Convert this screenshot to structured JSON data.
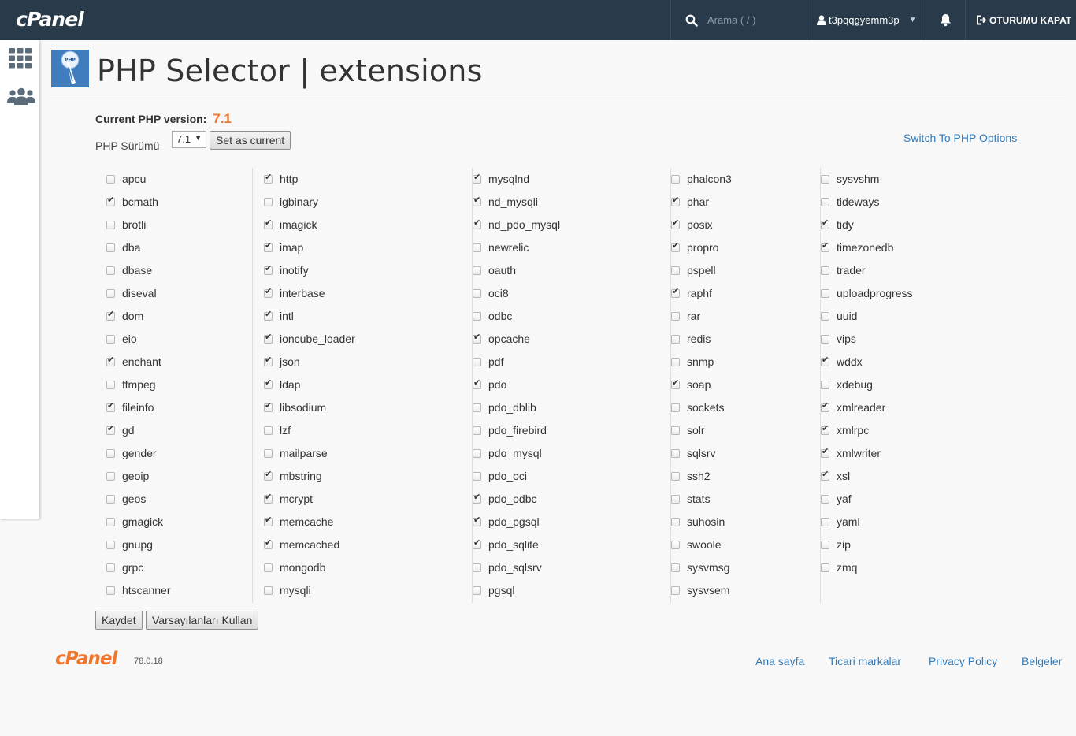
{
  "topbar": {
    "logo": "cPanel",
    "search_placeholder": "Arama ( / )",
    "username": "t3pqqgyemm3p",
    "logout_label": "OTURUMU KAPAT"
  },
  "page": {
    "title": "PHP Selector | extensions",
    "current_version_label": "Current PHP version:",
    "current_version_value": "7.1",
    "version_select_label": "PHP Sürümü",
    "version_select_value": "7.1",
    "set_current_label": "Set as current",
    "switch_link": "Switch To PHP Options",
    "save_label": "Kaydet",
    "defaults_label": "Varsayılanları Kullan"
  },
  "extensions": [
    [
      {
        "name": "apcu",
        "checked": false
      },
      {
        "name": "bcmath",
        "checked": true
      },
      {
        "name": "brotli",
        "checked": false
      },
      {
        "name": "dba",
        "checked": false
      },
      {
        "name": "dbase",
        "checked": false
      },
      {
        "name": "diseval",
        "checked": false
      },
      {
        "name": "dom",
        "checked": true
      },
      {
        "name": "eio",
        "checked": false
      },
      {
        "name": "enchant",
        "checked": true
      },
      {
        "name": "ffmpeg",
        "checked": false
      },
      {
        "name": "fileinfo",
        "checked": true
      },
      {
        "name": "gd",
        "checked": true
      },
      {
        "name": "gender",
        "checked": false
      },
      {
        "name": "geoip",
        "checked": false
      },
      {
        "name": "geos",
        "checked": false
      },
      {
        "name": "gmagick",
        "checked": false
      },
      {
        "name": "gnupg",
        "checked": false
      },
      {
        "name": "grpc",
        "checked": false
      },
      {
        "name": "htscanner",
        "checked": false
      }
    ],
    [
      {
        "name": "http",
        "checked": true
      },
      {
        "name": "igbinary",
        "checked": false
      },
      {
        "name": "imagick",
        "checked": true
      },
      {
        "name": "imap",
        "checked": true
      },
      {
        "name": "inotify",
        "checked": true
      },
      {
        "name": "interbase",
        "checked": true
      },
      {
        "name": "intl",
        "checked": true
      },
      {
        "name": "ioncube_loader",
        "checked": true
      },
      {
        "name": "json",
        "checked": true
      },
      {
        "name": "ldap",
        "checked": true
      },
      {
        "name": "libsodium",
        "checked": true
      },
      {
        "name": "lzf",
        "checked": false
      },
      {
        "name": "mailparse",
        "checked": false
      },
      {
        "name": "mbstring",
        "checked": true
      },
      {
        "name": "mcrypt",
        "checked": true
      },
      {
        "name": "memcache",
        "checked": true
      },
      {
        "name": "memcached",
        "checked": true
      },
      {
        "name": "mongodb",
        "checked": false
      },
      {
        "name": "mysqli",
        "checked": false
      }
    ],
    [
      {
        "name": "mysqlnd",
        "checked": true
      },
      {
        "name": "nd_mysqli",
        "checked": true
      },
      {
        "name": "nd_pdo_mysql",
        "checked": true
      },
      {
        "name": "newrelic",
        "checked": false
      },
      {
        "name": "oauth",
        "checked": false
      },
      {
        "name": "oci8",
        "checked": false
      },
      {
        "name": "odbc",
        "checked": false
      },
      {
        "name": "opcache",
        "checked": true
      },
      {
        "name": "pdf",
        "checked": false
      },
      {
        "name": "pdo",
        "checked": true
      },
      {
        "name": "pdo_dblib",
        "checked": false
      },
      {
        "name": "pdo_firebird",
        "checked": false
      },
      {
        "name": "pdo_mysql",
        "checked": false
      },
      {
        "name": "pdo_oci",
        "checked": false
      },
      {
        "name": "pdo_odbc",
        "checked": true
      },
      {
        "name": "pdo_pgsql",
        "checked": true
      },
      {
        "name": "pdo_sqlite",
        "checked": true
      },
      {
        "name": "pdo_sqlsrv",
        "checked": false
      },
      {
        "name": "pgsql",
        "checked": false
      }
    ],
    [
      {
        "name": "phalcon3",
        "checked": false
      },
      {
        "name": "phar",
        "checked": true
      },
      {
        "name": "posix",
        "checked": true
      },
      {
        "name": "propro",
        "checked": true
      },
      {
        "name": "pspell",
        "checked": false
      },
      {
        "name": "raphf",
        "checked": true
      },
      {
        "name": "rar",
        "checked": false
      },
      {
        "name": "redis",
        "checked": false
      },
      {
        "name": "snmp",
        "checked": false
      },
      {
        "name": "soap",
        "checked": true
      },
      {
        "name": "sockets",
        "checked": false
      },
      {
        "name": "solr",
        "checked": false
      },
      {
        "name": "sqlsrv",
        "checked": false
      },
      {
        "name": "ssh2",
        "checked": false
      },
      {
        "name": "stats",
        "checked": false
      },
      {
        "name": "suhosin",
        "checked": false
      },
      {
        "name": "swoole",
        "checked": false
      },
      {
        "name": "sysvmsg",
        "checked": false
      },
      {
        "name": "sysvsem",
        "checked": false
      }
    ],
    [
      {
        "name": "sysvshm",
        "checked": false
      },
      {
        "name": "tideways",
        "checked": false
      },
      {
        "name": "tidy",
        "checked": true
      },
      {
        "name": "timezonedb",
        "checked": true
      },
      {
        "name": "trader",
        "checked": false
      },
      {
        "name": "uploadprogress",
        "checked": false
      },
      {
        "name": "uuid",
        "checked": false
      },
      {
        "name": "vips",
        "checked": false
      },
      {
        "name": "wddx",
        "checked": true
      },
      {
        "name": "xdebug",
        "checked": false
      },
      {
        "name": "xmlreader",
        "checked": true
      },
      {
        "name": "xmlrpc",
        "checked": true
      },
      {
        "name": "xmlwriter",
        "checked": true
      },
      {
        "name": "xsl",
        "checked": true
      },
      {
        "name": "yaf",
        "checked": false
      },
      {
        "name": "yaml",
        "checked": false
      },
      {
        "name": "zip",
        "checked": false
      },
      {
        "name": "zmq",
        "checked": false
      }
    ]
  ],
  "footer": {
    "logo": "cPanel",
    "version": "78.0.18",
    "links": [
      "Ana sayfa",
      "Ticari markalar",
      "Privacy Policy",
      "Belgeler"
    ]
  }
}
